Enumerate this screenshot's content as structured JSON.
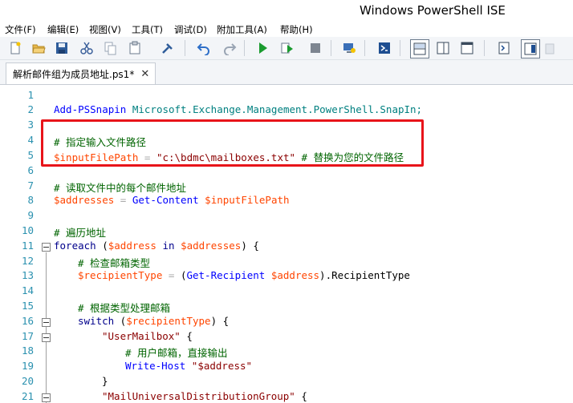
{
  "window": {
    "title": "Windows PowerShell ISE"
  },
  "menu": {
    "items": [
      "文件(F)",
      "编辑(E)",
      "视图(V)",
      "工具(T)",
      "调试(D)",
      "附加工具(A)",
      "帮助(H)"
    ]
  },
  "toolbar": {
    "icons": [
      "new-file",
      "open-file",
      "save",
      "cut",
      "copy",
      "paste",
      "clear",
      "undo",
      "redo",
      "run-script",
      "run-selection",
      "stop",
      "new-remote-tab",
      "start-powershell",
      "show-script-top",
      "show-script-right",
      "show-script-max",
      "show-commands",
      "show-command-addon"
    ]
  },
  "tab": {
    "label": "解析邮件组为成员地址.ps1*",
    "close_glyph": "✕"
  },
  "editor": {
    "lines": [
      {
        "n": "1"
      },
      {
        "n": "2"
      },
      {
        "n": "3"
      },
      {
        "n": "4"
      },
      {
        "n": "5"
      },
      {
        "n": "6"
      },
      {
        "n": "7"
      },
      {
        "n": "8"
      },
      {
        "n": "9"
      },
      {
        "n": "10"
      },
      {
        "n": "11"
      },
      {
        "n": "12"
      },
      {
        "n": "13"
      },
      {
        "n": "14"
      },
      {
        "n": "15"
      },
      {
        "n": "16"
      },
      {
        "n": "17"
      },
      {
        "n": "18"
      },
      {
        "n": "19"
      },
      {
        "n": "20"
      },
      {
        "n": "21"
      }
    ],
    "code": {
      "l2_cmd": "Add-PSSnapin",
      "l2_arg": "Microsoft.Exchange.Management.PowerShell.SnapIn;",
      "l4_comment": "# 指定输入文件路径",
      "l5_var": "$inputFilePath",
      "l5_op": " = ",
      "l5_str": "\"c:\\bdmc\\mailboxes.txt\"",
      "l5_comment": " # 替换为您的文件路径",
      "l7_comment": "# 读取文件中的每个邮件地址",
      "l8_var": "$addresses",
      "l8_op": " = ",
      "l8_cmd": "Get-Content",
      "l8_arg": " $inputFilePath",
      "l10_comment": "# 遍历地址",
      "l11_kw": "foreach",
      "l11_a": " (",
      "l11_var1": "$address",
      "l11_in": " in ",
      "l11_var2": "$addresses",
      "l11_b": ") {",
      "l12_comment": "# 检查邮箱类型",
      "l13_var": "$recipientType",
      "l13_op": " = ",
      "l13_paren": "(",
      "l13_cmd": "Get-Recipient",
      "l13_arg": " $address",
      "l13_close": ").",
      "l13_prop": "RecipientType",
      "l15_comment": "# 根据类型处理邮箱",
      "l16_kw": "switch",
      "l16_a": " (",
      "l16_var": "$recipientType",
      "l16_b": ") {",
      "l17_str": "\"UserMailbox\"",
      "l17_b": " {",
      "l18_comment": "# 用户邮箱，直接输出",
      "l19_cmd": "Write-Host",
      "l19_str": " \"$address\"",
      "l20_b": "}",
      "l21_str": "\"MailUniversalDistributionGroup\"",
      "l21_b": " {"
    }
  },
  "colors": {
    "highlight_border": "#e8141a",
    "line_number": "#2b91af",
    "comment": "#006400",
    "variable": "#ff4500",
    "string": "#8b0000",
    "command": "#0000ff",
    "keyword": "#00008b"
  }
}
